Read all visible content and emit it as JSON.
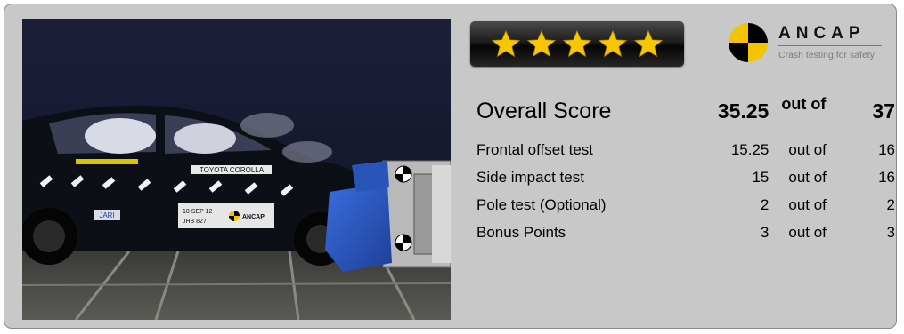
{
  "photo": {
    "car_badge": "TOYOTA COROLLA",
    "date_plate": "18 SEP 12",
    "plate_code": "JHB 827",
    "plate_logo": "ANCAP",
    "door_logo": "JARI"
  },
  "rating": {
    "stars": 5,
    "star_color": "#f7c600"
  },
  "logo": {
    "name": "ANCAP",
    "tagline": "Crash testing for safety"
  },
  "score": {
    "overall": {
      "label": "Overall Score",
      "value": "35.25",
      "out_of": "out of",
      "max": "37"
    },
    "tests": [
      {
        "label": "Frontal offset test",
        "value": "15.25",
        "out_of": "out of",
        "max": "16"
      },
      {
        "label": "Side impact test",
        "value": "15",
        "out_of": "out of",
        "max": "16"
      },
      {
        "label": "Pole test (Optional)",
        "value": "2",
        "out_of": "out of",
        "max": "2"
      },
      {
        "label": "Bonus Points",
        "value": "3",
        "out_of": "out of",
        "max": "3"
      }
    ]
  },
  "colors": {
    "panel_bg": "#c8c8c8",
    "panel_border": "#8a8a8a",
    "barrier_blue": "#2f5fc8"
  }
}
